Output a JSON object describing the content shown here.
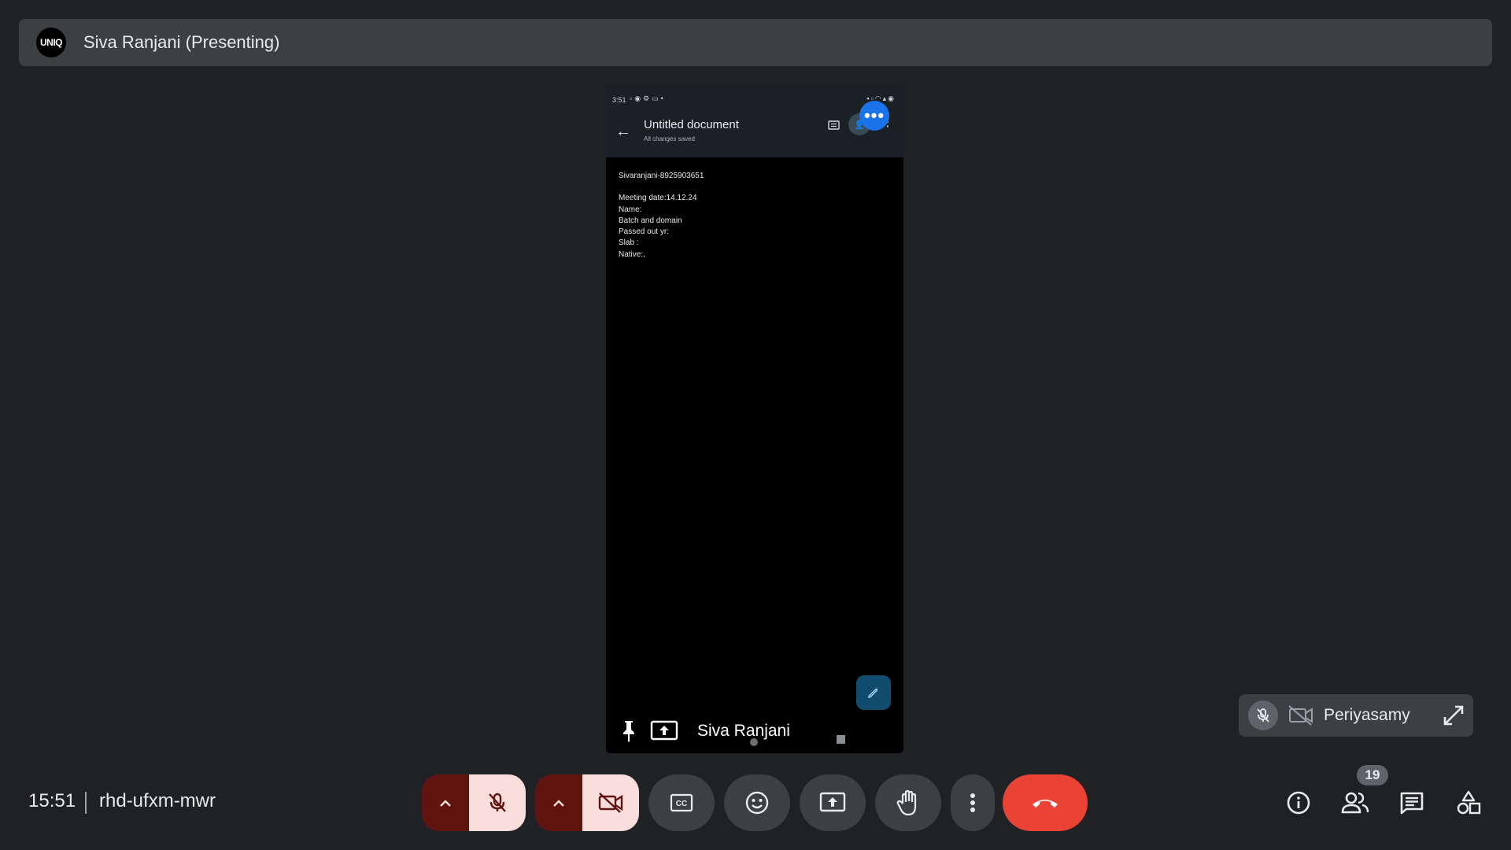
{
  "presenter_bar": {
    "logo_text": "UNIQ",
    "title": "Siva Ranjani (Presenting)"
  },
  "shared_screen": {
    "status_time": "3:51",
    "doc_title": "Untitled document",
    "doc_subtitle": "All changes saved",
    "doc_lines": [
      "Sivaranjani-8925903651",
      "",
      "Meeting date:14.12.24",
      "Name:",
      "Batch and domain",
      "Passed out yr:",
      "Slab :",
      "Native:,"
    ],
    "presenter_name": "Siva Ranjani"
  },
  "self_tile": {
    "name": "Periyasamy"
  },
  "meeting": {
    "time": "15:51",
    "code": "rhd-ufxm-mwr"
  },
  "controls": {
    "participants_count": "19"
  },
  "colors": {
    "background": "#202124",
    "bar": "#3c4043",
    "muted_accent": "#f9dedc",
    "muted_dark": "#601410",
    "hangup": "#ea4335",
    "blue": "#1a73e8"
  },
  "icons": {
    "mic": "mic-off-icon",
    "cam": "videocam-off-icon",
    "captions": "closed-caption-icon",
    "emoji": "emoji-icon",
    "present": "present-screen-icon",
    "hand": "raise-hand-icon",
    "more": "more-vert-icon",
    "hangup": "call-end-icon",
    "info": "info-icon",
    "people": "people-icon",
    "chat": "chat-icon",
    "activities": "activities-icon"
  }
}
